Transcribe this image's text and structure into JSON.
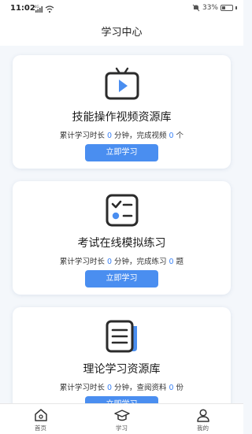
{
  "status_bar": {
    "time": "11:02",
    "net_label": "4G",
    "battery": "33%"
  },
  "header": {
    "title": "学习中心"
  },
  "cards": [
    {
      "title": "技能操作视频资源库",
      "stat_prefix": "累计学习时长",
      "stat_value_1": "0",
      "stat_mid": "分钟，完成视频",
      "stat_value_2": "0",
      "stat_suffix": "个",
      "button": "立即学习",
      "icon": "video-tv-icon"
    },
    {
      "title": "考试在线模拟练习",
      "stat_prefix": "累计学习时长",
      "stat_value_1": "0",
      "stat_mid": "分钟，完成练习",
      "stat_value_2": "0",
      "stat_suffix": "题",
      "button": "立即学习",
      "icon": "exam-checklist-icon"
    },
    {
      "title": "理论学习资源库",
      "stat_prefix": "累计学习时长",
      "stat_value_1": "0",
      "stat_mid": "分钟，查阅资料",
      "stat_value_2": "0",
      "stat_suffix": "份",
      "button": "立即学习",
      "icon": "document-icon"
    }
  ],
  "tabbar": [
    {
      "label": "首页",
      "icon": "home-icon"
    },
    {
      "label": "学习",
      "icon": "graduation-cap-icon"
    },
    {
      "label": "我的",
      "icon": "person-icon"
    }
  ],
  "colors": {
    "accent": "#4a8ef0",
    "number": "#3b82f6",
    "background": "#f4f7fb"
  }
}
